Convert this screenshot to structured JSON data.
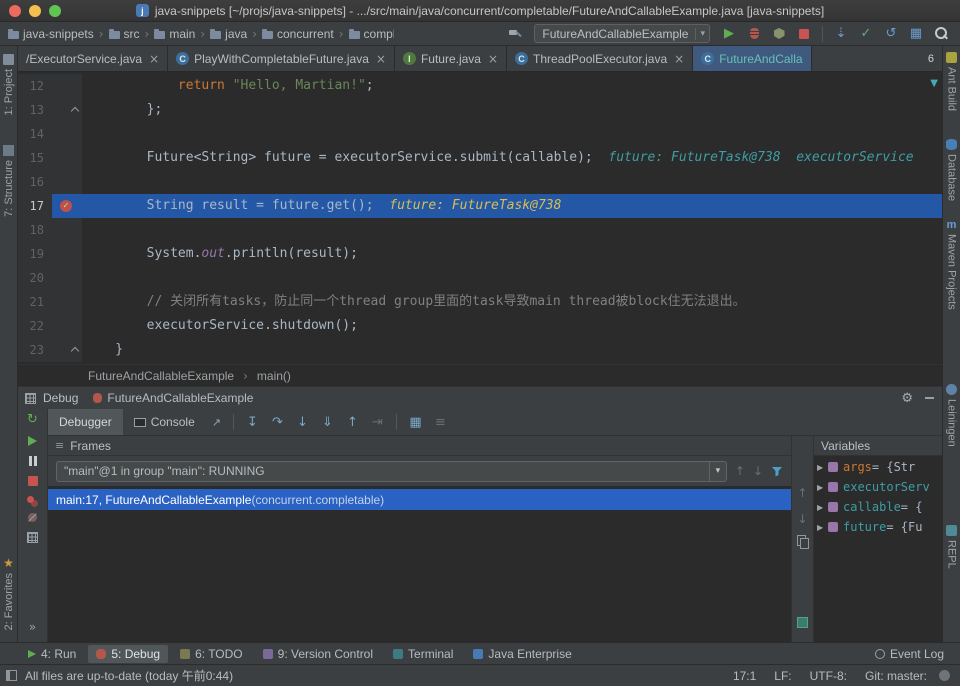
{
  "title_bar": {
    "title": "java-snippets [~/projs/java-snippets] - .../src/main/java/concurrent/completable/FutureAndCallableExample.java [java-snippets]"
  },
  "nav": {
    "crumbs": [
      "java-snippets",
      "src",
      "main",
      "java",
      "concurrent",
      "completable"
    ],
    "run_config": "FutureAndCallableExample"
  },
  "tabs": {
    "hidden_count": "6",
    "items": [
      {
        "label": "/ExecutorService.java",
        "icon": "none",
        "close": true,
        "active": false
      },
      {
        "label": "PlayWithCompletableFuture.java",
        "icon": "class",
        "close": true,
        "active": false
      },
      {
        "label": "Future.java",
        "icon": "interface",
        "close": true,
        "active": false
      },
      {
        "label": "ThreadPoolExecutor.java",
        "icon": "class",
        "close": true,
        "active": false
      },
      {
        "label": "FutureAndCalla",
        "icon": "class",
        "close": false,
        "active": true
      }
    ]
  },
  "editor": {
    "breadcrumb": {
      "class": "FutureAndCallableExample",
      "method": "main()"
    },
    "lines": [
      {
        "n": 12,
        "tok": [
          [
            "pl",
            "            "
          ],
          [
            "kw",
            "return"
          ],
          [
            "pl",
            " "
          ],
          [
            "st",
            "\"Hello, Martian!\""
          ],
          [
            "pl",
            ";"
          ]
        ]
      },
      {
        "n": 13,
        "fold": true,
        "tok": [
          [
            "pl",
            "        };"
          ]
        ]
      },
      {
        "n": 14,
        "tok": []
      },
      {
        "n": 15,
        "tok": [
          [
            "pl",
            "        Future<String> future = executorService.submit(callable);"
          ],
          [
            "h1",
            "  future: FutureTask@738  executorService"
          ]
        ]
      },
      {
        "n": 16,
        "tok": []
      },
      {
        "n": 17,
        "exec": true,
        "bp": true,
        "tok": [
          [
            "pl",
            "        String result = future.get();"
          ],
          [
            "h2",
            "  future: FutureTask@738"
          ]
        ]
      },
      {
        "n": 18,
        "tok": []
      },
      {
        "n": 19,
        "tok": [
          [
            "pl",
            "        System."
          ],
          [
            "fd",
            "out"
          ],
          [
            "pl",
            ".println(result);"
          ]
        ]
      },
      {
        "n": 20,
        "tok": []
      },
      {
        "n": 21,
        "tok": [
          [
            "cm",
            "        // 关闭所有tasks，防止同一个thread group里面的task导致main thread被block住无法退出。"
          ]
        ]
      },
      {
        "n": 22,
        "tok": [
          [
            "pl",
            "        executorService.shutdown();"
          ]
        ]
      },
      {
        "n": 23,
        "fold": true,
        "tok": [
          [
            "pl",
            "    }"
          ]
        ]
      }
    ]
  },
  "debug": {
    "header": {
      "label": "Debug",
      "tab": "FutureAndCallableExample"
    },
    "tabs": [
      {
        "label": "Debugger"
      },
      {
        "label": "Console"
      }
    ],
    "frames": {
      "title": "Frames",
      "thread": "\"main\"@1 in group \"main\": RUNNING",
      "rows": [
        {
          "text": "main:17, FutureAndCallableExample ",
          "pkg": "(concurrent.completable)"
        }
      ]
    },
    "variables": {
      "title": "Variables",
      "rows": [
        {
          "name": "args",
          "value": " = {Str",
          "kind": "param"
        },
        {
          "name": "executorServ",
          "value": "",
          "kind": "local"
        },
        {
          "name": "callable",
          "value": " = {",
          "kind": "local"
        },
        {
          "name": "future",
          "value": " = {Fu",
          "kind": "local"
        }
      ]
    }
  },
  "bottom_bar": {
    "left": [
      {
        "label": "4: Run",
        "icon": "run",
        "active": false
      },
      {
        "label": "5: Debug",
        "icon": "bug",
        "active": true
      },
      {
        "label": "6: TODO",
        "icon": "todo",
        "active": false
      },
      {
        "label": "9: Version Control",
        "icon": "vcs",
        "active": false
      },
      {
        "label": "Terminal",
        "icon": "terminal",
        "active": false
      },
      {
        "label": "Java Enterprise",
        "icon": "jee",
        "active": false
      }
    ],
    "right": [
      {
        "label": "Event Log",
        "icon": "event",
        "active": false
      }
    ]
  },
  "status_bar": {
    "left": "All files are up-to-date (today 午前0:44)",
    "right": [
      "17:1",
      "LF:",
      "UTF-8:",
      "Git: master:"
    ]
  },
  "left_stripe": [
    {
      "label": "1: Project",
      "icon": "project"
    },
    {
      "label": "7: Structure",
      "icon": "structure"
    },
    {
      "label": "2: Favorites",
      "icon": "star"
    }
  ],
  "right_stripe": [
    {
      "label": "Ant Build",
      "icon": "ant"
    },
    {
      "label": "Database",
      "icon": "db"
    },
    {
      "label": "Maven Projects",
      "icon": "maven"
    },
    {
      "label": "Leiningen",
      "icon": "lein"
    },
    {
      "label": "REPL",
      "icon": "repl"
    }
  ],
  "icons": {
    "dropdown_arrow": "▾",
    "close": "×",
    "crumb_separator": "›",
    "hidden_tabs_arrow": "▼",
    "run": "▶",
    "rerun": "↻",
    "update_project": "⇣",
    "commit": "✓",
    "revert": "↺",
    "view_grid": "▦",
    "gear": "⚙",
    "console_pin": "↗",
    "show_execution_point": "↧",
    "step_over": "↷",
    "step_into": "↓",
    "force_step_into": "⇓",
    "step_out": "↑",
    "run_to_cursor": "⇥",
    "evaluate_expression": "▦",
    "layout_settings": "≡",
    "more": "»",
    "frames_panel": "≡",
    "nav_up": "↑",
    "nav_down": "↓",
    "twisty": "▶",
    "breakpoint_check": "✓",
    "star": "★",
    "maven": "m"
  },
  "colors": {
    "editor_bg": "#2b2b2b",
    "panel_bg": "#3c3f41",
    "exec_line": "#2458a6",
    "selection_blue": "#2a62c4",
    "active_tab": "#40597e",
    "keyword": "#cc7832",
    "string": "#6a8759",
    "comment": "#808080",
    "hint_teal": "#3d9ea5",
    "hint_yellow": "#d9be52",
    "breakpoint_red": "#c1504c"
  }
}
